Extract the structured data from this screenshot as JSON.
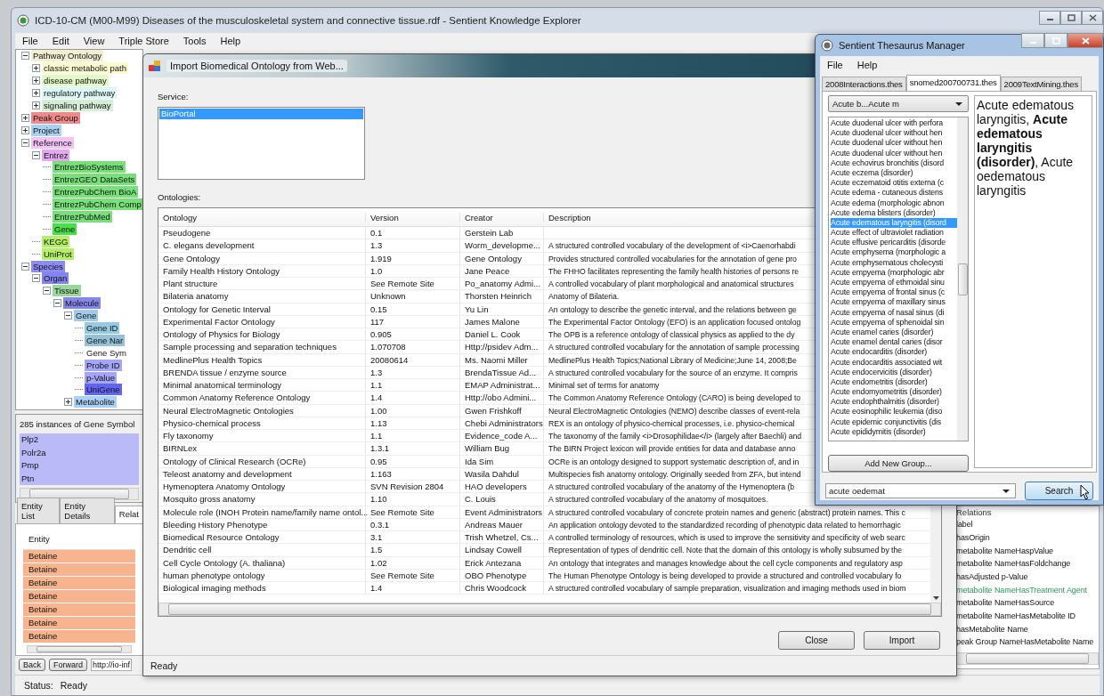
{
  "main_window": {
    "title": "ICD-10-CM (M00-M99) Diseases of the musculoskeletal system and connective tissue.rdf - Sentient Knowledge Explorer",
    "menu": [
      "File",
      "Edit",
      "View",
      "Triple Store",
      "Tools",
      "Help"
    ],
    "tree": [
      {
        "children": [
          {
            "label": "Pathway Ontology",
            "color": "#f2eed2",
            "expanded": true,
            "children": [
              {
                "label": "classic metabolic path",
                "color": "#fafad0",
                "expanded": false
              },
              {
                "label": "disease pathway",
                "color": "#e2f8c8",
                "expanded": false
              },
              {
                "label": "regulatory pathway",
                "color": "#dcf8f6",
                "expanded": false
              },
              {
                "label": "signaling pathway",
                "color": "#d6eed6",
                "expanded": false
              }
            ]
          }
        ]
      },
      {
        "label": "Peak Group",
        "color": "#f08a8a",
        "expanded": false
      },
      {
        "label": "Project",
        "color": "#a8d2f2",
        "expanded": false
      },
      {
        "label": "Reference",
        "color": "#f2c4f8",
        "expanded": true,
        "children": [
          {
            "label": "Entrez",
            "color": "#e4a8f0",
            "expanded": true,
            "children": [
              {
                "label": "EntrezBioSystems",
                "color": "#78e078"
              },
              {
                "label": "EntrezGEO DataSets",
                "color": "#78e078"
              },
              {
                "label": "EntrezPubChem BioA",
                "color": "#78e078"
              },
              {
                "label": "EntrezPubChem Comp",
                "color": "#78e078"
              },
              {
                "label": "EntrezPubMed",
                "color": "#78e078"
              },
              {
                "label": "Gene",
                "color": "#48e048"
              }
            ]
          },
          {
            "label": "KEGG",
            "color": "#b4f066"
          },
          {
            "label": "UniProt",
            "color": "#b4f066"
          }
        ]
      },
      {
        "label": "Species",
        "color": "#8c8cf2",
        "expanded": true,
        "children": [
          {
            "label": "Organ",
            "color": "#8484f0",
            "expanded": true,
            "children": [
              {
                "label": "Tissue",
                "color": "#98d898",
                "expanded": true,
                "children": [
                  {
                    "label": "Molecule",
                    "color": "#8686ea",
                    "expanded": true,
                    "children": [
                      {
                        "label": "Gene",
                        "color": "#a2cbe8",
                        "expanded": true,
                        "children": [
                          {
                            "label": "Gene ID",
                            "color": "#96cae2"
                          },
                          {
                            "label": "Gene Nar",
                            "color": "#96c2d8"
                          },
                          {
                            "label": "Gene Sym"
                          },
                          {
                            "label": "Probe ID",
                            "color": "#a4a4f8"
                          },
                          {
                            "label": "p-Value",
                            "color": "#a4a4f8"
                          },
                          {
                            "label": "UniGene",
                            "color": "#6464f2"
                          }
                        ]
                      },
                      {
                        "label": "Metabolite",
                        "color": "#aad2f8",
                        "expanded": false
                      }
                    ]
                  }
                ]
              }
            ]
          }
        ]
      }
    ],
    "instances": {
      "title": "285 instances of Gene Symbol",
      "items": [
        "Plp2",
        "Polr2a",
        "Pmp",
        "Ptn"
      ]
    },
    "tabs": [
      {
        "label": "Entity List",
        "selected": false
      },
      {
        "label": "Entity Details",
        "selected": false
      },
      {
        "label": "Relat",
        "selected": true
      }
    ],
    "entity_table": {
      "column": "Entity",
      "rows": [
        "Betaine",
        "Betaine",
        "Betaine",
        "Betaine",
        "Betaine",
        "Betaine",
        "Betaine"
      ]
    },
    "back_button": "Back",
    "forward_button": "Forward",
    "url": "http://io-inf",
    "relations": {
      "title": "Relations",
      "items": [
        {
          "label": "label",
          "highlighted": false
        },
        {
          "label": "hasOrigin",
          "highlighted": false
        },
        {
          "label": "metabolite NameHaspValue",
          "highlighted": false
        },
        {
          "label": "metabolite NameHasFoldchange",
          "highlighted": false
        },
        {
          "label": "hasAdjusted p-Value",
          "highlighted": false
        },
        {
          "label": "metabolite NameHasTreatment Agent",
          "highlighted": true
        },
        {
          "label": "metabolite NameHasSource",
          "highlighted": false
        },
        {
          "label": "metabolite NameHasMetabolite ID",
          "highlighted": false
        },
        {
          "label": "hasMetabolite Name",
          "highlighted": false
        },
        {
          "label": "peak Group NameHasMetabolite Name",
          "highlighted": false
        }
      ]
    },
    "status": {
      "label": "Status:",
      "value": "Ready"
    }
  },
  "import_dialog": {
    "title": "Import Biomedical Ontology from Web...",
    "service_label": "Service:",
    "services": [
      {
        "label": "BioPortal",
        "selected": true
      }
    ],
    "ontologies_label": "Ontologies:",
    "columns": [
      "Ontology",
      "Version",
      "Creator",
      "Description"
    ],
    "rows": [
      {
        "ontology": "Pseudogene",
        "version": "0.1",
        "creator": "Gerstein Lab"
      },
      {
        "ontology": "C. elegans development",
        "version": "1.3",
        "creator": "Worm_developme...",
        "description": "A structured controlled vocabulary of the development of <i>Caenorhabdi"
      },
      {
        "ontology": "Gene Ontology",
        "version": "1.919",
        "creator": "Gene Ontology",
        "description": "Provides structured controlled vocabularies for the annotation of gene pro"
      },
      {
        "ontology": "Family Health History Ontology",
        "version": "1.0",
        "creator": "Jane Peace",
        "description": "The FHHO facilitates representing the family health histories of persons re"
      },
      {
        "ontology": "Plant structure",
        "version": "See Remote Site",
        "creator": "Po_anatomy Admi...",
        "description": "A controlled vocabulary of plant morphological and anatomical structures"
      },
      {
        "ontology": "Bilateria anatomy",
        "version": "Unknown",
        "creator": "Thorsten Heinrich",
        "description": "Anatomy of Bilateria."
      },
      {
        "ontology": "Ontology for Genetic Interval",
        "version": "0.15",
        "creator": "Yu Lin",
        "description": "An ontology to describe the genetic interval, and the relations between ge"
      },
      {
        "ontology": "Experimental Factor Ontology",
        "version": "117",
        "creator": "James Malone",
        "description": "The Experimental Factor Ontology (EFO) is an application focused ontolog"
      },
      {
        "ontology": "Ontology of Physics for Biology",
        "version": "0.905",
        "creator": "Daniel L. Cook",
        "description": "The OPB is a reference ontology of classical physics as applied to the dy"
      },
      {
        "ontology": "Sample processing and separation techniques",
        "version": "1.070708",
        "creator": "Http://psidev Adm...",
        "description": "A structured controlled vocabulary for the annotation of sample processing"
      },
      {
        "ontology": "MedlinePlus Health Topics",
        "version": "20080614",
        "creator": "Ms. Naomi Miller",
        "description": "MedlinePlus Health Topics;National Library of Medicine;June 14, 2008;Be"
      },
      {
        "ontology": "BRENDA tissue / enzyme source",
        "version": "1.3",
        "creator": "BrendaTissue Ad...",
        "description": "A structured controlled vocabulary for the source of an enzyme. It compris"
      },
      {
        "ontology": "Minimal anatomical terminology",
        "version": "1.1",
        "creator": "EMAP Administrat...",
        "description": "Minimal set of terms for anatomy"
      },
      {
        "ontology": "Common Anatomy Reference Ontology",
        "version": "1.4",
        "creator": "Http://obo Admini...",
        "description": "The Common Anatomy Reference Ontology (CARO) is being developed to"
      },
      {
        "ontology": "Neural ElectroMagnetic Ontologies",
        "version": "1.00",
        "creator": "Gwen Frishkoff",
        "description": "Neural ElectroMagnetic Ontologies (NEMO) describe classes of event-rela"
      },
      {
        "ontology": "Physico-chemical process",
        "version": "1.13",
        "creator": "Chebi Administrators",
        "description": "REX is an ontology of physico-chemical processes, i.e. physico-chemical"
      },
      {
        "ontology": "Fly taxonomy",
        "version": "1.1",
        "creator": "Evidence_code A...",
        "description": "The taxonomy of the family <i>Drosophilidae</i> (largely after Baechli) and"
      },
      {
        "ontology": "BIRNLex",
        "version": "1.3.1",
        "creator": "William Bug",
        "description": "The BIRN Project lexicon will provide entities for data and database anno"
      },
      {
        "ontology": "Ontology of Clinical Research (OCRe)",
        "version": "0.95",
        "creator": "Ida Sim",
        "description": "OCRe is an ontology designed to support systematic description of, and in"
      },
      {
        "ontology": "Teleost anatomy and development",
        "version": "1.163",
        "creator": "Wasila Dahdul",
        "description": "Multispecies fish anatomy ontology. Originally seeded from ZFA, but intend"
      },
      {
        "ontology": "Hymenoptera Anatomy Ontology",
        "version": "SVN Revision 2804",
        "creator": "HAO developers",
        "description": "A structured controlled vocabulary of the anatomy of the Hymenoptera (b"
      },
      {
        "ontology": "Mosquito gross anatomy",
        "version": "1.10",
        "creator": "C. Louis",
        "description": "A structured controlled vocabulary of the anatomy of mosquitoes."
      },
      {
        "ontology": "Molecule role (INOH Protein name/family name ontol...",
        "version": "See Remote Site",
        "creator": "Event Administrators",
        "description": "A structured controlled vocabulary of concrete protein names and generic (abstract) protein names. This c"
      },
      {
        "ontology": "Bleeding History Phenotype",
        "version": "0.3.1",
        "creator": "Andreas Mauer",
        "description": "An application ontology devoted to the standardized recording of phenotypic data related to hemorrhagic"
      },
      {
        "ontology": "Biomedical Resource Ontology",
        "version": "3.1",
        "creator": "Trish Whetzel, Cs...",
        "description": "A controlled terminology of resources, which is used to improve the sensitivity and specificity of web searc"
      },
      {
        "ontology": "Dendritic cell",
        "version": "1.5",
        "creator": "Lindsay Cowell",
        "description": "Representation of types of dendritic cell. Note that the domain of this ontology is wholly subsumed by the"
      },
      {
        "ontology": "Cell Cycle Ontology (A. thaliana)",
        "version": "1.02",
        "creator": "Erick Antezana",
        "description": "An ontology that integrates and manages knowledge about the cell cycle components and regulatory asp"
      },
      {
        "ontology": "human phenotype ontology",
        "version": "See Remote Site",
        "creator": "OBO Phenotype",
        "description": "The Human Phenotype Ontology is being developed to provide a structured and controlled vocabulary fo"
      },
      {
        "ontology": "Biological imaging methods",
        "version": "1.4",
        "creator": "Chris Woodcock",
        "description": "A structured controlled vocabulary of sample preparation, visualization and imaging methods used in biom"
      }
    ],
    "buttons": [
      "Close",
      "Import"
    ],
    "status": "Ready"
  },
  "thesaurus": {
    "title": "Sentient Thesaurus Manager",
    "menu": [
      "File",
      "Help"
    ],
    "tabs": [
      {
        "label": "2008Interactions.thes",
        "selected": false
      },
      {
        "label": "snomed200700731.thes",
        "selected": true
      },
      {
        "label": "2009TextMining.thes",
        "selected": false
      }
    ],
    "range": "Acute b...Acute m",
    "terms": [
      {
        "label": "Acute duodenal ulcer with perfora",
        "selected": false
      },
      {
        "label": "Acute duodenal ulcer without hen",
        "selected": false
      },
      {
        "label": "Acute duodenal ulcer without hen",
        "selected": false
      },
      {
        "label": "Acute duodenal ulcer without hen",
        "selected": false
      },
      {
        "label": "Acute echovirus bronchitis (disord",
        "selected": false
      },
      {
        "label": "Acute eczema (disorder)",
        "selected": false
      },
      {
        "label": "Acute eczematoid otitis externa (c",
        "selected": false
      },
      {
        "label": "Acute edema - cutaneous distens",
        "selected": false
      },
      {
        "label": "Acute edema (morphologic abnon",
        "selected": false
      },
      {
        "label": "Acute edema blisters (disorder)",
        "selected": false
      },
      {
        "label": "Acute edematous laryngitis (disord",
        "selected": true
      },
      {
        "label": "Acute effect of ultraviolet radiation",
        "selected": false
      },
      {
        "label": "Acute effusive pericarditis (disorde",
        "selected": false
      },
      {
        "label": "Acute emphysema (morphologic a",
        "selected": false
      },
      {
        "label": "Acute emphysematous cholecysti",
        "selected": false
      },
      {
        "label": "Acute empyema (morphologic abr",
        "selected": false
      },
      {
        "label": "Acute empyema of ethmoidal sinu",
        "selected": false
      },
      {
        "label": "Acute empyema of frontal sinus (c",
        "selected": false
      },
      {
        "label": "Acute empyema of maxillary sinus",
        "selected": false
      },
      {
        "label": "Acute empyema of nasal sinus (di",
        "selected": false
      },
      {
        "label": "Acute empyema of sphenoidal sin",
        "selected": false
      },
      {
        "label": "Acute enamel caries (disorder)",
        "selected": false
      },
      {
        "label": "Acute enamel dental caries (disor",
        "selected": false
      },
      {
        "label": "Acute endocarditis (disorder)",
        "selected": false
      },
      {
        "label": "Acute endocarditis associated wit",
        "selected": false
      },
      {
        "label": "Acute endocervicitis (disorder)",
        "selected": false
      },
      {
        "label": "Acute endometritis (disorder)",
        "selected": false
      },
      {
        "label": "Acute endomyometritis (disorder)",
        "selected": false
      },
      {
        "label": "Acute endophthalmitis (disorder)",
        "selected": false
      },
      {
        "label": "Acute eosinophilic leukemia (diso",
        "selected": false
      },
      {
        "label": "Acute epidemic conjunctivitis (dis",
        "selected": false
      },
      {
        "label": "Acute epididymitis (disorder)",
        "selected": false
      }
    ],
    "detail": "Acute edematous laryngitis, **Acute edematous laryngitis (disorder)**, Acute oedematous laryngitis",
    "add_group_button": "Add New Group...",
    "search_value": "acute oedemat",
    "search_button": "Search"
  }
}
